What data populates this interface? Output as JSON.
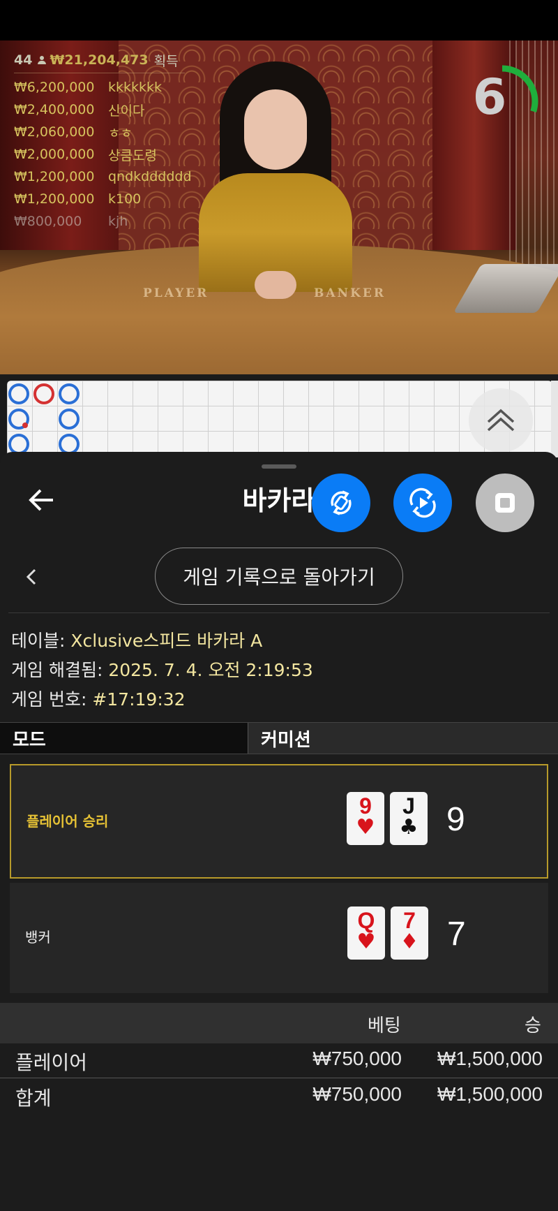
{
  "video": {
    "winners_summary": {
      "count": "44",
      "total": "₩21,204,473",
      "label": "획득"
    },
    "winners": [
      {
        "amount": "₩6,200,000",
        "name": "kkkkkkk"
      },
      {
        "amount": "₩2,400,000",
        "name": "신이다"
      },
      {
        "amount": "₩2,060,000",
        "name": "ㅎㅎ"
      },
      {
        "amount": "₩2,000,000",
        "name": "상큼도령"
      },
      {
        "amount": "₩1,200,000",
        "name": "qndkdddddd"
      },
      {
        "amount": "₩1,200,000",
        "name": "k100"
      },
      {
        "amount": "₩800,000",
        "name": "kjh"
      }
    ],
    "countdown": "6",
    "countdown_fraction": 0.3,
    "table_labels": {
      "player": "PLAYER",
      "banker": "BANKER"
    }
  },
  "sheet": {
    "title": "바카라",
    "back_to_history": "게임 기록으로 돌아가기"
  },
  "info": {
    "table_label": "테이블:",
    "table_value": "Xclusive스피드 바카라 A",
    "resolved_label": "게임 해결됨:",
    "resolved_value": "2025. 7. 4. 오전 2:19:53",
    "game_no_label": "게임 번호:",
    "game_no_value": "#17:19:32"
  },
  "tabs": {
    "mode": "모드",
    "commission": "커미션"
  },
  "results": {
    "player": {
      "label": "플레이어 승리",
      "cards": [
        {
          "rank": "9",
          "suit": "♥"
        },
        {
          "rank": "J",
          "suit": "♣"
        }
      ],
      "score": "9"
    },
    "banker": {
      "label": "뱅커",
      "cards": [
        {
          "rank": "Q",
          "suit": "♥"
        },
        {
          "rank": "7",
          "suit": "♦"
        }
      ],
      "score": "7"
    }
  },
  "bets": {
    "header_bet": "베팅",
    "header_win": "승",
    "rows": [
      {
        "label": "플레이어",
        "bet": "₩750,000",
        "win": "₩1,500,000"
      },
      {
        "label": "합계",
        "bet": "₩750,000",
        "win": "₩1,500,000"
      }
    ]
  },
  "colors": {
    "accent_blue": "#0a7cf6",
    "winner_gold": "#d6c35e",
    "win_border": "#b79a2a",
    "card_red": "#d8141c",
    "timer_green": "#1fae3c"
  },
  "icons": [
    "back-arrow-icon",
    "rotate-icon",
    "replay-icon",
    "stop-icon",
    "chevron-left-icon",
    "double-chevron-up-icon",
    "person-icon"
  ]
}
